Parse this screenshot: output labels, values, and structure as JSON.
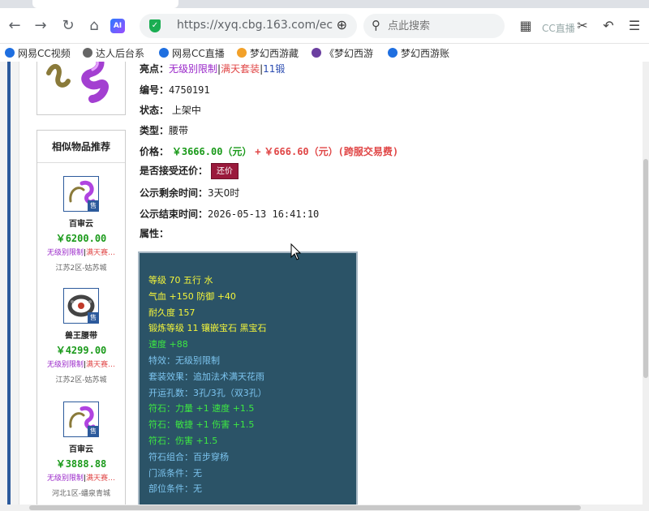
{
  "browser": {
    "url": "https://xyq.cbg.163.com/ec",
    "search_placeholder": "点此搜索",
    "ai_label": "AI",
    "watermark": "CC直播",
    "bookmarks": [
      {
        "label": "网易CC视频",
        "color": "#1f6fe0"
      },
      {
        "label": "达人后台系",
        "color": "#666666"
      },
      {
        "label": "网易CC直播",
        "color": "#1f6fe0"
      },
      {
        "label": "梦幻西游藏",
        "color": "#f2a12a"
      },
      {
        "label": "《梦幻西游",
        "color": "#6b3fa0"
      },
      {
        "label": "梦幻西游账",
        "color": "#1f6fe0"
      }
    ]
  },
  "sidebar": {
    "title": "相似物品推荐",
    "items": [
      {
        "name": "百审云",
        "price": "￥6200.00",
        "tag1": "无级别限制",
        "tag2": "满天赛…",
        "server": "江苏2区-姑苏城",
        "sold": "售"
      },
      {
        "name": "兽王腰带",
        "price": "￥4299.00",
        "tag1": "无级别限制",
        "tag2": "满天赛…",
        "server": "江苏2区-姑苏城",
        "sold": "售"
      },
      {
        "name": "百审云",
        "price": "￥3888.88",
        "tag1": "无级别限制",
        "tag2": "满天赛…",
        "server": "河北1区-蟠泉青城",
        "sold": "售"
      }
    ]
  },
  "detail": {
    "highlights_label": "亮点：",
    "highlights_1": "无级别限制",
    "highlights_sep1": "|",
    "highlights_2": "满天套装",
    "highlights_sep2": "|",
    "highlights_3": "11锻",
    "id_label": "编号：",
    "id_value": "4750191",
    "status_label": "状态：",
    "status_value": "上架中",
    "type_label": "类型：",
    "type_value": "腰带",
    "price_label": "价格：",
    "price_value": "￥3666.00（元）",
    "price_plus": "+",
    "fee_value": "￥666.60（元）(跨服交易费)",
    "bargain_label": "是否接受还价：",
    "bargain_button": "还价",
    "remain_label": "公示剩余时间：",
    "remain_value": "3天0时",
    "end_label": "公示结束时间：",
    "end_value": "2026-05-13 16:41:10",
    "attr_label": "属性："
  },
  "attributes": [
    {
      "text": "等级 70 五行 水",
      "color": "yellow"
    },
    {
      "text": "气血 +150 防御 +40",
      "color": "yellow"
    },
    {
      "text": "耐久度 157",
      "color": "yellow"
    },
    {
      "text": "锻炼等级 11 镶嵌宝石 黑宝石",
      "color": "yellow"
    },
    {
      "text": "速度 +88",
      "color": "green"
    },
    {
      "text": "特效：无级别限制",
      "color": "blue"
    },
    {
      "text": "套装效果：追加法术满天花雨",
      "color": "blue"
    },
    {
      "text": "开运孔数：3孔/3孔（双3孔）",
      "color": "blue"
    },
    {
      "text": "符石：力量 +1 速度 +1.5",
      "color": "green"
    },
    {
      "text": "符石：敏捷 +1 伤害 +1.5",
      "color": "green"
    },
    {
      "text": "符石：伤害 +1.5",
      "color": "green"
    },
    {
      "text": "符石组合：百步穿杨",
      "color": "blue"
    },
    {
      "text": "门派条件：无",
      "color": "blue"
    },
    {
      "text": "部位条件：无",
      "color": "blue"
    }
  ]
}
